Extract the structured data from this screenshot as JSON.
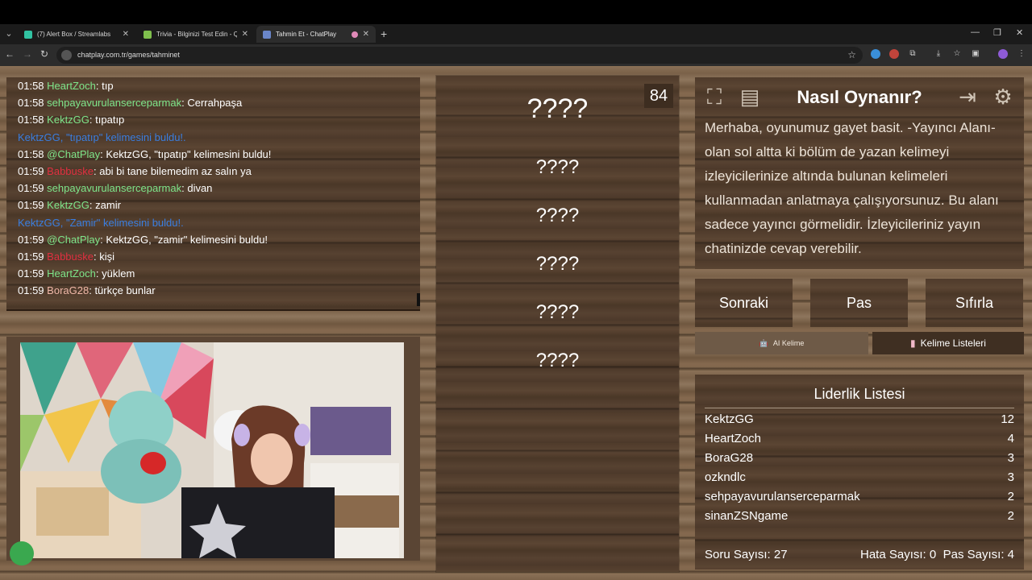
{
  "browser": {
    "tabs": [
      {
        "title": "(7) Alert Box / Streamlabs",
        "color": "#31c3a2"
      },
      {
        "title": "Trivia - Bilginizi Test Edin - Qui",
        "color": "#7fbf4d"
      },
      {
        "title": "Tahmin Et - ChatPlay",
        "color": "#6a86c9"
      }
    ],
    "url": "chatplay.com.tr/games/tahminet"
  },
  "chat": {
    "lines": [
      {
        "time": "01:58",
        "user": "HeartZoch",
        "user_color": "#7ee58a",
        "msg": ": tıp"
      },
      {
        "time": "01:58",
        "user": "sehpayavurulanserceparmak",
        "user_color": "#7ee58a",
        "msg": ": Cerrahpaşa"
      },
      {
        "time": "01:58",
        "user": "KektzGG",
        "user_color": "#7ee58a",
        "msg": ": tıpatıp"
      },
      {
        "time": "",
        "user": "KektzGG, \"tıpatıp\" kelimesini buldu!.",
        "user_color": "#3a7ee0",
        "msg": ""
      },
      {
        "time": "01:58",
        "user": "@ChatPlay",
        "user_color": "#7ee58a",
        "msg": ": KektzGG, \"tıpatıp\" kelimesini buldu!"
      },
      {
        "time": "01:59",
        "user": "Babbuske",
        "user_color": "#e03040",
        "msg": ": abi bi tane bilemedim az salın ya"
      },
      {
        "time": "01:59",
        "user": "sehpayavurulanserceparmak",
        "user_color": "#7ee58a",
        "msg": ": divan"
      },
      {
        "time": "01:59",
        "user": "KektzGG",
        "user_color": "#7ee58a",
        "msg": ": zamir"
      },
      {
        "time": "",
        "user": "KektzGG, \"Zamir\" kelimesini buldu!.",
        "user_color": "#3a7ee0",
        "msg": ""
      },
      {
        "time": "01:59",
        "user": "@ChatPlay",
        "user_color": "#7ee58a",
        "msg": ": KektzGG, \"zamir\" kelimesini buldu!"
      },
      {
        "time": "01:59",
        "user": "Babbuske",
        "user_color": "#e03040",
        "msg": ": kişi"
      },
      {
        "time": "01:59",
        "user": "HeartZoch",
        "user_color": "#7ee58a",
        "msg": ": yüklem"
      },
      {
        "time": "01:59",
        "user": "BoraG28",
        "user_color": "#f0b8a8",
        "msg": ": türkçe bunlar"
      }
    ]
  },
  "game": {
    "question_number": "84",
    "words": [
      "????",
      "????",
      "????",
      "????",
      "????",
      "????"
    ]
  },
  "howto": {
    "title": "Nasıl Oynanır?",
    "text": "Merhaba, oyunumuz gayet basit. -Yayıncı Alanı- olan sol altta ki bölüm de yazan kelimeyi izleyicilerinize altında bulunan kelimeleri kullanmadan anlatmaya çalışıyorsunuz. Bu alanı sadece yayıncı görmelidir. İzleyicileriniz yayın chatinizde cevap verebilir."
  },
  "actions": {
    "next": "Sonraki",
    "pass": "Pas",
    "reset": "Sıfırla",
    "ai_word": "AI Kelime",
    "word_lists": "Kelime Listeleri"
  },
  "leaderboard": {
    "title": "Liderlik Listesi",
    "rows": [
      {
        "name": "KektzGG",
        "score": "12"
      },
      {
        "name": "HeartZoch",
        "score": "4"
      },
      {
        "name": "BoraG28",
        "score": "3"
      },
      {
        "name": "ozkndlc",
        "score": "3"
      },
      {
        "name": "sehpayavurulanserceparmak",
        "score": "2"
      },
      {
        "name": "sinanZSNgame",
        "score": "2"
      }
    ],
    "question_count": "Soru Sayısı: 27",
    "error_count": "Hata Sayısı: 0",
    "pass_count": "Pas Sayısı: 4"
  }
}
